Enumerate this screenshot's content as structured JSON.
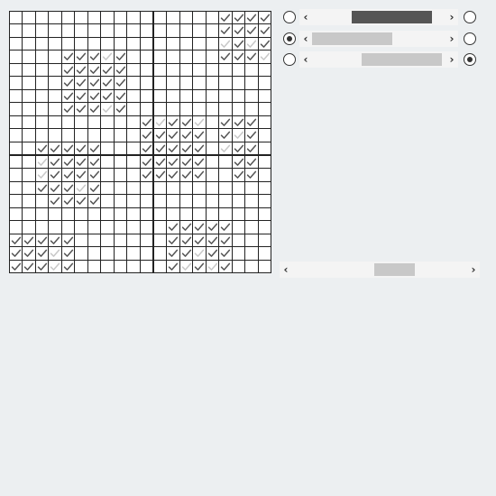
{
  "grid": {
    "rows": 20,
    "cols": 20,
    "checked_dark": [
      [
        0,
        16
      ],
      [
        0,
        17
      ],
      [
        0,
        18
      ],
      [
        0,
        19
      ],
      [
        1,
        16
      ],
      [
        1,
        17
      ],
      [
        1,
        18
      ],
      [
        1,
        19
      ],
      [
        2,
        17
      ],
      [
        2,
        19
      ],
      [
        3,
        4
      ],
      [
        3,
        5
      ],
      [
        3,
        6
      ],
      [
        3,
        8
      ],
      [
        3,
        16
      ],
      [
        3,
        17
      ],
      [
        3,
        18
      ],
      [
        4,
        4
      ],
      [
        4,
        5
      ],
      [
        4,
        6
      ],
      [
        4,
        7
      ],
      [
        4,
        8
      ],
      [
        5,
        4
      ],
      [
        5,
        5
      ],
      [
        5,
        6
      ],
      [
        5,
        7
      ],
      [
        5,
        8
      ],
      [
        6,
        4
      ],
      [
        6,
        5
      ],
      [
        6,
        6
      ],
      [
        6,
        7
      ],
      [
        6,
        8
      ],
      [
        7,
        4
      ],
      [
        7,
        5
      ],
      [
        7,
        6
      ],
      [
        7,
        8
      ],
      [
        8,
        10
      ],
      [
        8,
        12
      ],
      [
        8,
        13
      ],
      [
        8,
        16
      ],
      [
        8,
        17
      ],
      [
        8,
        18
      ],
      [
        9,
        10
      ],
      [
        9,
        11
      ],
      [
        9,
        12
      ],
      [
        9,
        13
      ],
      [
        9,
        14
      ],
      [
        9,
        16
      ],
      [
        9,
        18
      ],
      [
        10,
        2
      ],
      [
        10,
        3
      ],
      [
        10,
        4
      ],
      [
        10,
        5
      ],
      [
        10,
        6
      ],
      [
        10,
        10
      ],
      [
        10,
        11
      ],
      [
        10,
        12
      ],
      [
        10,
        13
      ],
      [
        10,
        14
      ],
      [
        10,
        17
      ],
      [
        10,
        18
      ],
      [
        11,
        3
      ],
      [
        11,
        4
      ],
      [
        11,
        5
      ],
      [
        11,
        6
      ],
      [
        11,
        10
      ],
      [
        11,
        11
      ],
      [
        11,
        12
      ],
      [
        11,
        13
      ],
      [
        11,
        14
      ],
      [
        11,
        17
      ],
      [
        11,
        18
      ],
      [
        12,
        3
      ],
      [
        12,
        4
      ],
      [
        12,
        5
      ],
      [
        12,
        6
      ],
      [
        12,
        10
      ],
      [
        12,
        11
      ],
      [
        12,
        12
      ],
      [
        12,
        13
      ],
      [
        12,
        14
      ],
      [
        12,
        17
      ],
      [
        12,
        18
      ],
      [
        13,
        2
      ],
      [
        13,
        3
      ],
      [
        13,
        4
      ],
      [
        13,
        6
      ],
      [
        14,
        3
      ],
      [
        14,
        4
      ],
      [
        14,
        5
      ],
      [
        14,
        6
      ],
      [
        16,
        12
      ],
      [
        16,
        13
      ],
      [
        16,
        14
      ],
      [
        16,
        15
      ],
      [
        16,
        16
      ],
      [
        17,
        0
      ],
      [
        17,
        1
      ],
      [
        17,
        2
      ],
      [
        17,
        3
      ],
      [
        17,
        4
      ],
      [
        17,
        12
      ],
      [
        17,
        13
      ],
      [
        17,
        14
      ],
      [
        17,
        15
      ],
      [
        17,
        16
      ],
      [
        18,
        0
      ],
      [
        18,
        1
      ],
      [
        18,
        2
      ],
      [
        18,
        4
      ],
      [
        18,
        12
      ],
      [
        18,
        13
      ],
      [
        18,
        15
      ],
      [
        18,
        16
      ],
      [
        19,
        0
      ],
      [
        19,
        1
      ],
      [
        19,
        2
      ],
      [
        19,
        4
      ],
      [
        19,
        12
      ],
      [
        19,
        14
      ],
      [
        19,
        16
      ]
    ],
    "checked_light": [
      [
        2,
        16
      ],
      [
        2,
        18
      ],
      [
        3,
        7
      ],
      [
        3,
        19
      ],
      [
        7,
        7
      ],
      [
        8,
        11
      ],
      [
        8,
        14
      ],
      [
        9,
        17
      ],
      [
        10,
        16
      ],
      [
        11,
        2
      ],
      [
        12,
        2
      ],
      [
        13,
        5
      ],
      [
        18,
        3
      ],
      [
        18,
        14
      ],
      [
        19,
        3
      ],
      [
        19,
        13
      ],
      [
        19,
        15
      ]
    ]
  },
  "rows": [
    {
      "left_checked": false,
      "right_checked": false,
      "thumb_start": 0.3,
      "thumb_width": 0.6,
      "thumb_color": "#555555"
    },
    {
      "left_checked": true,
      "right_checked": false,
      "thumb_start": 0.0,
      "thumb_width": 0.6,
      "thumb_color": "#c8c8c8"
    },
    {
      "left_checked": false,
      "right_checked": true,
      "thumb_start": 0.37,
      "thumb_width": 0.6,
      "thumb_color": "#c8c8c8"
    }
  ],
  "hscroll": {
    "thumb_start": 0.47,
    "thumb_width": 0.23
  },
  "icons": {
    "left_arrow": "‹",
    "right_arrow": "›"
  }
}
